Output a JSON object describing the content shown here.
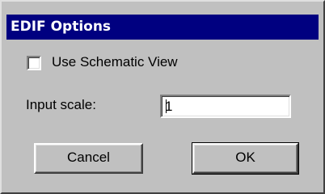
{
  "dialog": {
    "title": "EDIF Options",
    "use_schematic_view": {
      "label": "Use Schematic View",
      "checked": false
    },
    "input_scale": {
      "label": "Input scale:",
      "value": "1"
    },
    "buttons": {
      "cancel_label": "Cancel",
      "ok_label": "OK"
    }
  },
  "colors": {
    "titlebar": "#000080",
    "title_text": "#ffffff",
    "dialog_bg": "#c0c0c0",
    "field_bg": "#ffffff"
  }
}
